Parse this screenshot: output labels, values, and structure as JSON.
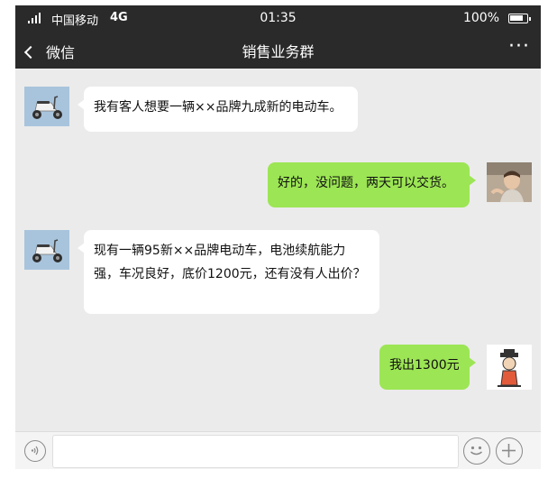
{
  "status_bar": {
    "carrier": "中国移动",
    "network": "4G",
    "time": "01:35",
    "battery": "100%"
  },
  "nav": {
    "back_label": "微信",
    "title": "销售业务群",
    "more_label": "···"
  },
  "messages": [
    {
      "side": "left",
      "avatar": "scooter-avatar",
      "text": "我有客人想要一辆××品牌九成新的电动车。"
    },
    {
      "side": "right",
      "avatar": "child-photo-avatar",
      "text": "好的，没问题，两天可以交货。"
    },
    {
      "side": "left",
      "avatar": "scooter-avatar",
      "text": "现有一辆95新××品牌电动车，电池续航能力强，车况良好，底价1200元，还有没有人出价？"
    },
    {
      "side": "right",
      "avatar": "cartoon-avatar",
      "text": "我出1300元"
    }
  ],
  "input_bar": {
    "text_value": "",
    "icons": [
      "voice-icon",
      "emoji-icon",
      "plus-icon"
    ]
  },
  "colors": {
    "bar_background": "#2a2a2a",
    "chat_background": "#ebebeb",
    "own_bubble": "#9ce554",
    "other_bubble": "#ffffff"
  }
}
